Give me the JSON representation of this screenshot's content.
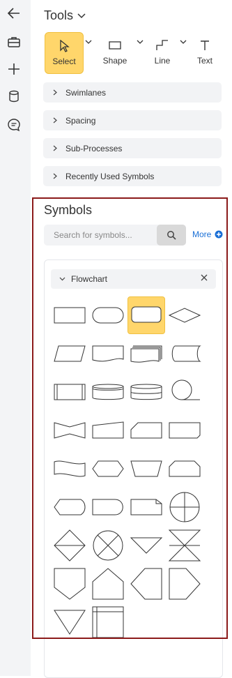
{
  "rail": {
    "icons": [
      "back-arrow-icon",
      "toolbox-icon",
      "plus-icon",
      "database-icon",
      "comment-icon"
    ]
  },
  "tools": {
    "title": "Tools",
    "buttons": [
      {
        "id": "select",
        "label": "Select",
        "active": true
      },
      {
        "id": "shape",
        "label": "Shape",
        "active": false
      },
      {
        "id": "line",
        "label": "Line",
        "active": false
      },
      {
        "id": "text",
        "label": "Text",
        "active": false
      }
    ]
  },
  "sections": [
    "Swimlanes",
    "Spacing",
    "Sub-Processes",
    "Recently Used Symbols"
  ],
  "symbols": {
    "title": "Symbols",
    "search_placeholder": "Search for symbols...",
    "more_label": "More",
    "category": "Flowchart",
    "selected_index": 2,
    "shapes": [
      "process",
      "terminator",
      "rounded-process",
      "decision",
      "data",
      "document",
      "multi-document",
      "stored-data",
      "predefined-process",
      "database",
      "direct-data",
      "sequential-data",
      "collate-tape",
      "manual-input",
      "card",
      "punched-card",
      "punched-tape",
      "preparation",
      "manual-operation",
      "loop-limit",
      "display",
      "delay",
      "off-page-ref",
      "summing-junction",
      "sort",
      "or",
      "merge",
      "extract",
      "off-page-connector",
      "pentagon",
      "left-tab",
      "right-tab",
      "merge-triangle",
      "internal-storage"
    ]
  },
  "colors": {
    "active_bg": "#ffd66b",
    "frame": "#8b1a1a",
    "link": "#1a6fd6"
  }
}
